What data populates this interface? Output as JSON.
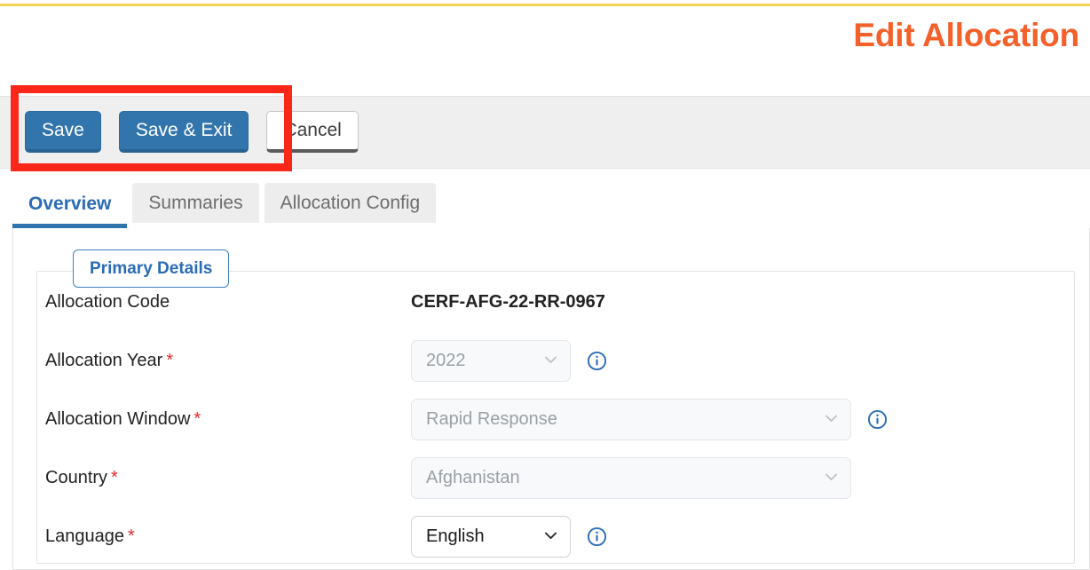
{
  "page": {
    "title": "Edit Allocation",
    "title_color": "#f4602a",
    "accent_rule_color": "#f7d254"
  },
  "toolbar": {
    "buttons": [
      {
        "label": "Save",
        "style": "primary"
      },
      {
        "label": "Save & Exit",
        "style": "primary"
      },
      {
        "label": "Cancel",
        "style": "secondary"
      }
    ],
    "primary_color": "#3275ac"
  },
  "annotation": {
    "color": "#fb2819",
    "targets": "Save, Save & Exit"
  },
  "tabs": [
    {
      "label": "Overview",
      "active": true
    },
    {
      "label": "Summaries",
      "active": false
    },
    {
      "label": "Allocation Config",
      "active": false
    }
  ],
  "fieldset": {
    "legend": "Primary Details",
    "legend_color": "#2b6cb5"
  },
  "fields": [
    {
      "label": "Allocation Code",
      "required": false,
      "type": "static",
      "value": "CERF-AFG-22-RR-0967",
      "info": false
    },
    {
      "label": "Allocation Year",
      "required": true,
      "type": "select",
      "value": "2022",
      "disabled": true,
      "width": "small",
      "info": true
    },
    {
      "label": "Allocation Window",
      "required": true,
      "type": "select",
      "value": "Rapid Response",
      "disabled": true,
      "width": "large",
      "info": true
    },
    {
      "label": "Country",
      "required": true,
      "type": "select",
      "value": "Afghanistan",
      "disabled": true,
      "width": "large",
      "info": false
    },
    {
      "label": "Language",
      "required": true,
      "type": "select",
      "value": "English",
      "disabled": false,
      "width": "small",
      "info": true
    }
  ],
  "required_marker": "*",
  "icons": {
    "chevron_down": "chevron-down-icon",
    "info": "info-circle-icon"
  }
}
